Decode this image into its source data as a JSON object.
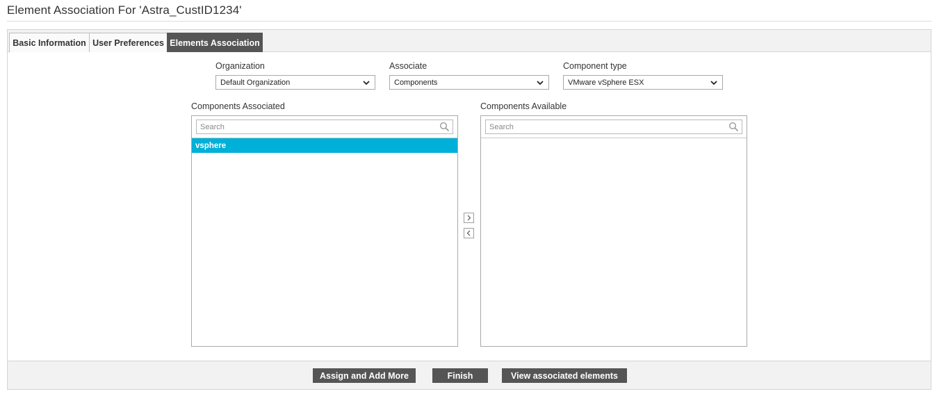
{
  "page": {
    "title": "Element Association For 'Astra_CustID1234'"
  },
  "tabs": [
    {
      "label": "Basic Information",
      "active": false
    },
    {
      "label": "User Preferences",
      "active": false
    },
    {
      "label": "Elements Association",
      "active": true
    }
  ],
  "filters": {
    "organization": {
      "label": "Organization",
      "value": "Default Organization"
    },
    "associate": {
      "label": "Associate",
      "value": "Components"
    },
    "component_type": {
      "label": "Component type",
      "value": "VMware vSphere ESX"
    }
  },
  "associated": {
    "label": "Components Associated",
    "search_placeholder": "Search",
    "items": [
      "vsphere"
    ]
  },
  "available": {
    "label": "Components Available",
    "search_placeholder": "Search",
    "items": []
  },
  "icons": {
    "dropdown": "chevron-down-icon",
    "search": "search-icon",
    "move_right": "chevron-right-icon",
    "move_left": "chevron-left-icon"
  },
  "colors": {
    "active_tab": "#555555",
    "selected_item": "#00b0d8",
    "button": "#555555"
  },
  "actions": {
    "assign_add_more": "Assign and Add More",
    "finish": "Finish",
    "view_associated": "View associated elements"
  }
}
